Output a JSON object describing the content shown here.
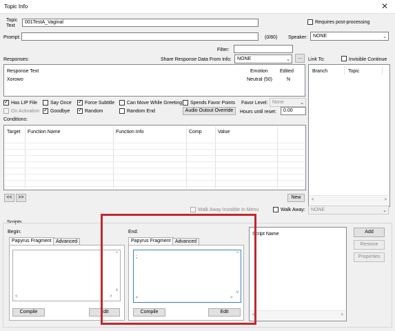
{
  "window": {
    "title": "Topic Info",
    "close_glyph": "✕"
  },
  "topic": {
    "label_line1": "Topic",
    "label_line2": "Text",
    "value": "001TestA_Vaginal"
  },
  "requires_post_processing": {
    "label": "Requires post-processing",
    "checked": false
  },
  "prompt": {
    "label": "Prompt:",
    "value": "",
    "counter": "(0/80)"
  },
  "speaker": {
    "label": "Speaker:",
    "value": "NONE"
  },
  "filter": {
    "label": "Filter:",
    "value": ""
  },
  "responses": {
    "label": "Responses:",
    "share_label": "Share Response Data From Info:",
    "share_value": "NONE",
    "share_button": "...",
    "columns": [
      "Response Text",
      "Emotion",
      "Edited"
    ],
    "rows": [
      {
        "text": "Xorowo",
        "emotion": "Neutral (50)",
        "edited": "N"
      }
    ]
  },
  "link_to": {
    "label": "Link To:",
    "invisible_continue": {
      "label": "Invisible Continue",
      "checked": false
    },
    "columns": [
      "Branch",
      "Topic"
    ]
  },
  "flags": {
    "has_lip_file": {
      "label": "Has LIP File",
      "checked": true
    },
    "say_once": {
      "label": "Say Once",
      "checked": false
    },
    "force_subtitle": {
      "label": "Force Subtitle",
      "checked": true
    },
    "can_move_while_greeting": {
      "label": "Can Move While Greeting",
      "checked": false
    },
    "spends_favor_points": {
      "label": "Spends Favor Points",
      "checked": false
    },
    "favor_level_label": "Favor Level:",
    "favor_level_value": "None",
    "on_activation": {
      "label": "On Activation",
      "checked": false
    },
    "goodbye": {
      "label": "Goodbye",
      "checked": true
    },
    "random": {
      "label": "Random",
      "checked": true
    },
    "random_end": {
      "label": "Random End",
      "checked": false
    },
    "audio_output_override": "Audio Outout Override",
    "hours_until_reset_label": "Hours until reset:",
    "hours_until_reset_value": "0.00"
  },
  "conditions": {
    "label": "Conditions:",
    "columns": [
      "Target",
      "Function Name",
      "Function Info",
      "Comp",
      "Value"
    ],
    "prev_button": "<<",
    "next_button": ">>",
    "new_button": "New"
  },
  "walk_away": {
    "invisible_label": "Walk Away Invisible In Menu",
    "label": "Walk Away:",
    "value": "NONE"
  },
  "scripts": {
    "label": "Scripts",
    "begin": {
      "label": "Begin:",
      "tab_papyrus": "Papyrus Fragment",
      "tab_advanced": "Advanced",
      "text": "",
      "compile": "Compile",
      "edit": "Edit"
    },
    "end": {
      "label": "End:",
      "tab_papyrus": "Papyrus Fragment",
      "tab_advanced": "Advanced",
      "text": ";",
      "compile": "Compile",
      "edit": "Edit"
    },
    "script_name_header": "Script Name",
    "add": "Add",
    "remove": "Remove",
    "properties": "Properties"
  },
  "highlight_color": "#c0282e"
}
